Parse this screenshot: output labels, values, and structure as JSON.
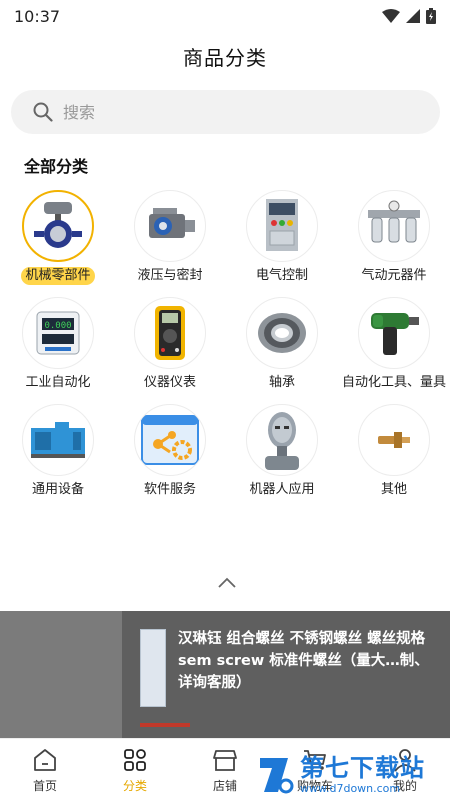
{
  "status": {
    "time": "10:37"
  },
  "header": {
    "title": "商品分类"
  },
  "search": {
    "placeholder": "搜索"
  },
  "section": {
    "title": "全部分类"
  },
  "categories": [
    {
      "label": "机械零部件",
      "icon": "butterfly-valve-icon",
      "active": true
    },
    {
      "label": "液压与密封",
      "icon": "hydraulic-pump-icon",
      "active": false
    },
    {
      "label": "电气控制",
      "icon": "control-cabinet-icon",
      "active": false
    },
    {
      "label": "气动元器件",
      "icon": "pneumatic-filter-icon",
      "active": false
    },
    {
      "label": "工业自动化",
      "icon": "digital-controller-icon",
      "active": false
    },
    {
      "label": "仪器仪表",
      "icon": "multimeter-icon",
      "active": false
    },
    {
      "label": "轴承",
      "icon": "bearing-icon",
      "active": false
    },
    {
      "label": "自动化工具、量具",
      "icon": "impact-wrench-icon",
      "active": false
    },
    {
      "label": "通用设备",
      "icon": "industrial-unit-icon",
      "active": false
    },
    {
      "label": "软件服务",
      "icon": "software-gears-icon",
      "active": false
    },
    {
      "label": "机器人应用",
      "icon": "robot-head-icon",
      "active": false
    },
    {
      "label": "其他",
      "icon": "brass-fitting-icon",
      "active": false
    }
  ],
  "product": {
    "title": "汉琳钰 组合螺丝 不锈钢螺丝 螺丝规格 sem screw 标准件螺丝（量大…制、详询客服）"
  },
  "tabbar": {
    "items": [
      {
        "label": "首页",
        "icon": "home-icon"
      },
      {
        "label": "分类",
        "icon": "category-grid-icon"
      },
      {
        "label": "店铺",
        "icon": "store-icon"
      },
      {
        "label": "购物车",
        "icon": "cart-icon"
      },
      {
        "label": "我的",
        "icon": "user-icon"
      }
    ],
    "active_index": 1
  },
  "watermark": {
    "title": "第七下载站",
    "url": "www.d7down.com"
  },
  "colors": {
    "accent": "#f2b200",
    "watermark": "#1e78d6",
    "overlay": "#5f5f5f"
  }
}
